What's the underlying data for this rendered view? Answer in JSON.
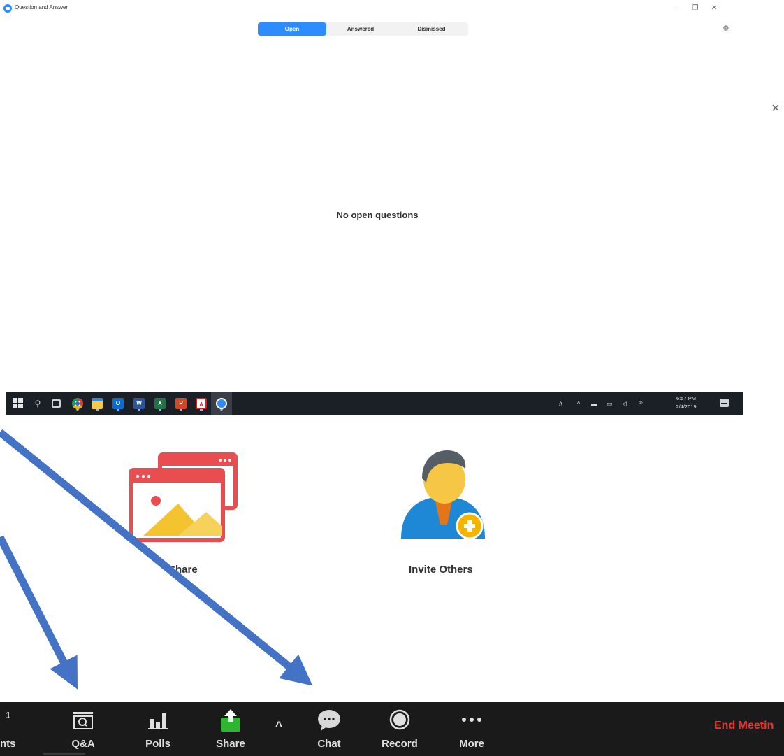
{
  "qa_window": {
    "title": "Question and Answer",
    "controls": {
      "minimize": "–",
      "restore": "❐",
      "close": "✕"
    },
    "tabs": [
      {
        "label": "Open",
        "selected": true
      },
      {
        "label": "Answered",
        "selected": false
      },
      {
        "label": "Dismissed",
        "selected": false
      }
    ],
    "settings_icon": "gear-icon",
    "empty_message": "No open questions",
    "panel_close": "×"
  },
  "taskbar": {
    "clock_time": "6:57 PM",
    "clock_date": "2/4/2019",
    "apps": [
      "Chrome",
      "File Explorer",
      "Outlook",
      "Word",
      "Excel",
      "PowerPoint",
      "Acrobat",
      "Zoom"
    ],
    "app_badges": {
      "outlook": "O",
      "word": "W",
      "excel": "X",
      "ppt": "P",
      "acrobat": "A"
    },
    "tray_icons": {
      "people": "ጰ",
      "caret": "^",
      "battery": "▬",
      "network": "▭",
      "volume": "◁",
      "pen": "ꟹ"
    }
  },
  "meeting": {
    "share_label": "Share",
    "invite_label": "Invite Others",
    "colors": {
      "share_red": "#e94d4f",
      "share_yellow": "#f4c430",
      "invite_blue": "#1e88d6",
      "invite_skin": "#f5c744",
      "invite_hair": "#555d66",
      "invite_badge": "#f4b400"
    }
  },
  "arrows": {
    "color": "#4472c4"
  },
  "toolbar": {
    "participants_count": "1",
    "participants_label": "nts",
    "qa_label": "Q&A",
    "polls_label": "Polls",
    "share_label": "Share",
    "caret": "^",
    "chat_label": "Chat",
    "record_label": "Record",
    "more_label": "More",
    "end_meeting_label": "End Meetin",
    "colors": {
      "share_green": "#2fb52f",
      "end_red": "#e8352e"
    }
  }
}
